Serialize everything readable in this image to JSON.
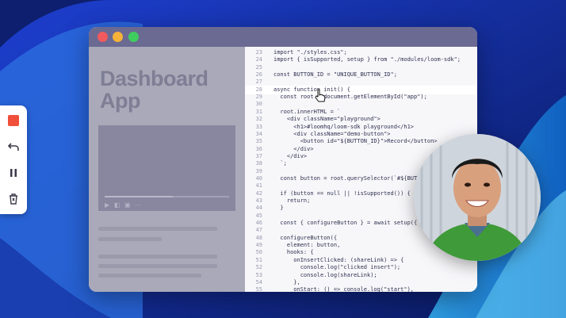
{
  "window": {
    "title_dots": [
      "close",
      "minimize",
      "zoom"
    ]
  },
  "dashboard": {
    "title_line1": "Dashboard",
    "title_line2": "App"
  },
  "video": {
    "controls": [
      "play-icon",
      "volume-icon",
      "captions-icon",
      "fullscreen-icon"
    ],
    "progress": 0.55
  },
  "code": {
    "lines": [
      {
        "n": "23",
        "t": "import \"./styles.css\";"
      },
      {
        "n": "24",
        "t": "import { isSupported, setup } from \"./modules/loom-sdk\";"
      },
      {
        "n": "25",
        "t": ""
      },
      {
        "n": "26",
        "t": "const BUTTON_ID = \"UNIQUE_BUTTON_ID\";"
      },
      {
        "n": "27",
        "t": ""
      },
      {
        "n": "28",
        "t": "async function init() {"
      },
      {
        "n": "29",
        "t": "  const root = document.getElementById(\"app\");"
      },
      {
        "n": "30",
        "t": ""
      },
      {
        "n": "31",
        "t": "  root.innerHTML = `"
      },
      {
        "n": "32",
        "t": "    <div className=\"playground\">"
      },
      {
        "n": "33",
        "t": "      <h1>#loomhq/loom-sdk playground</h1>"
      },
      {
        "n": "34",
        "t": "      <div className=\"demo-button\">"
      },
      {
        "n": "35",
        "t": "        <button id=\"${BUTTON_ID}\">Record</button>"
      },
      {
        "n": "36",
        "t": "      </div>"
      },
      {
        "n": "37",
        "t": "    </div>"
      },
      {
        "n": "38",
        "t": "  `;"
      },
      {
        "n": "39",
        "t": ""
      },
      {
        "n": "40",
        "t": "  const button = root.querySelector(`#${BUTTON_ID}`);"
      },
      {
        "n": "41",
        "t": ""
      },
      {
        "n": "42",
        "t": "  if (button == null || !isSupported()) {"
      },
      {
        "n": "43",
        "t": "    return;"
      },
      {
        "n": "44",
        "t": "  }"
      },
      {
        "n": "45",
        "t": ""
      },
      {
        "n": "46",
        "t": "  const { configureButton } = await setup({ apiKey"
      },
      {
        "n": "47",
        "t": ""
      },
      {
        "n": "48",
        "t": "  configureButton({"
      },
      {
        "n": "49",
        "t": "    element: button,"
      },
      {
        "n": "50",
        "t": "    hooks: {"
      },
      {
        "n": "51",
        "t": "      onInsertClicked: (shareLink) => {"
      },
      {
        "n": "52",
        "t": "        console.log(\"clicked insert\");"
      },
      {
        "n": "53",
        "t": "        console.log(shareLink);"
      },
      {
        "n": "54",
        "t": "      },"
      },
      {
        "n": "55",
        "t": "      onStart: () => console.log(\"start\"),"
      }
    ],
    "highlighted_line": "28"
  },
  "toolbar": {
    "buttons": [
      {
        "name": "stop-record-button",
        "icon": "stop-icon"
      },
      {
        "name": "undo-button",
        "icon": "undo-icon"
      },
      {
        "name": "pause-button",
        "icon": "pause-icon"
      },
      {
        "name": "delete-button",
        "icon": "trash-icon"
      }
    ]
  },
  "colors": {
    "background": "#0d1f6e",
    "window_titlebar": "#6a6a92",
    "record": "#f0503a",
    "keyword": "#2a4ed8",
    "string": "#c4365a"
  }
}
